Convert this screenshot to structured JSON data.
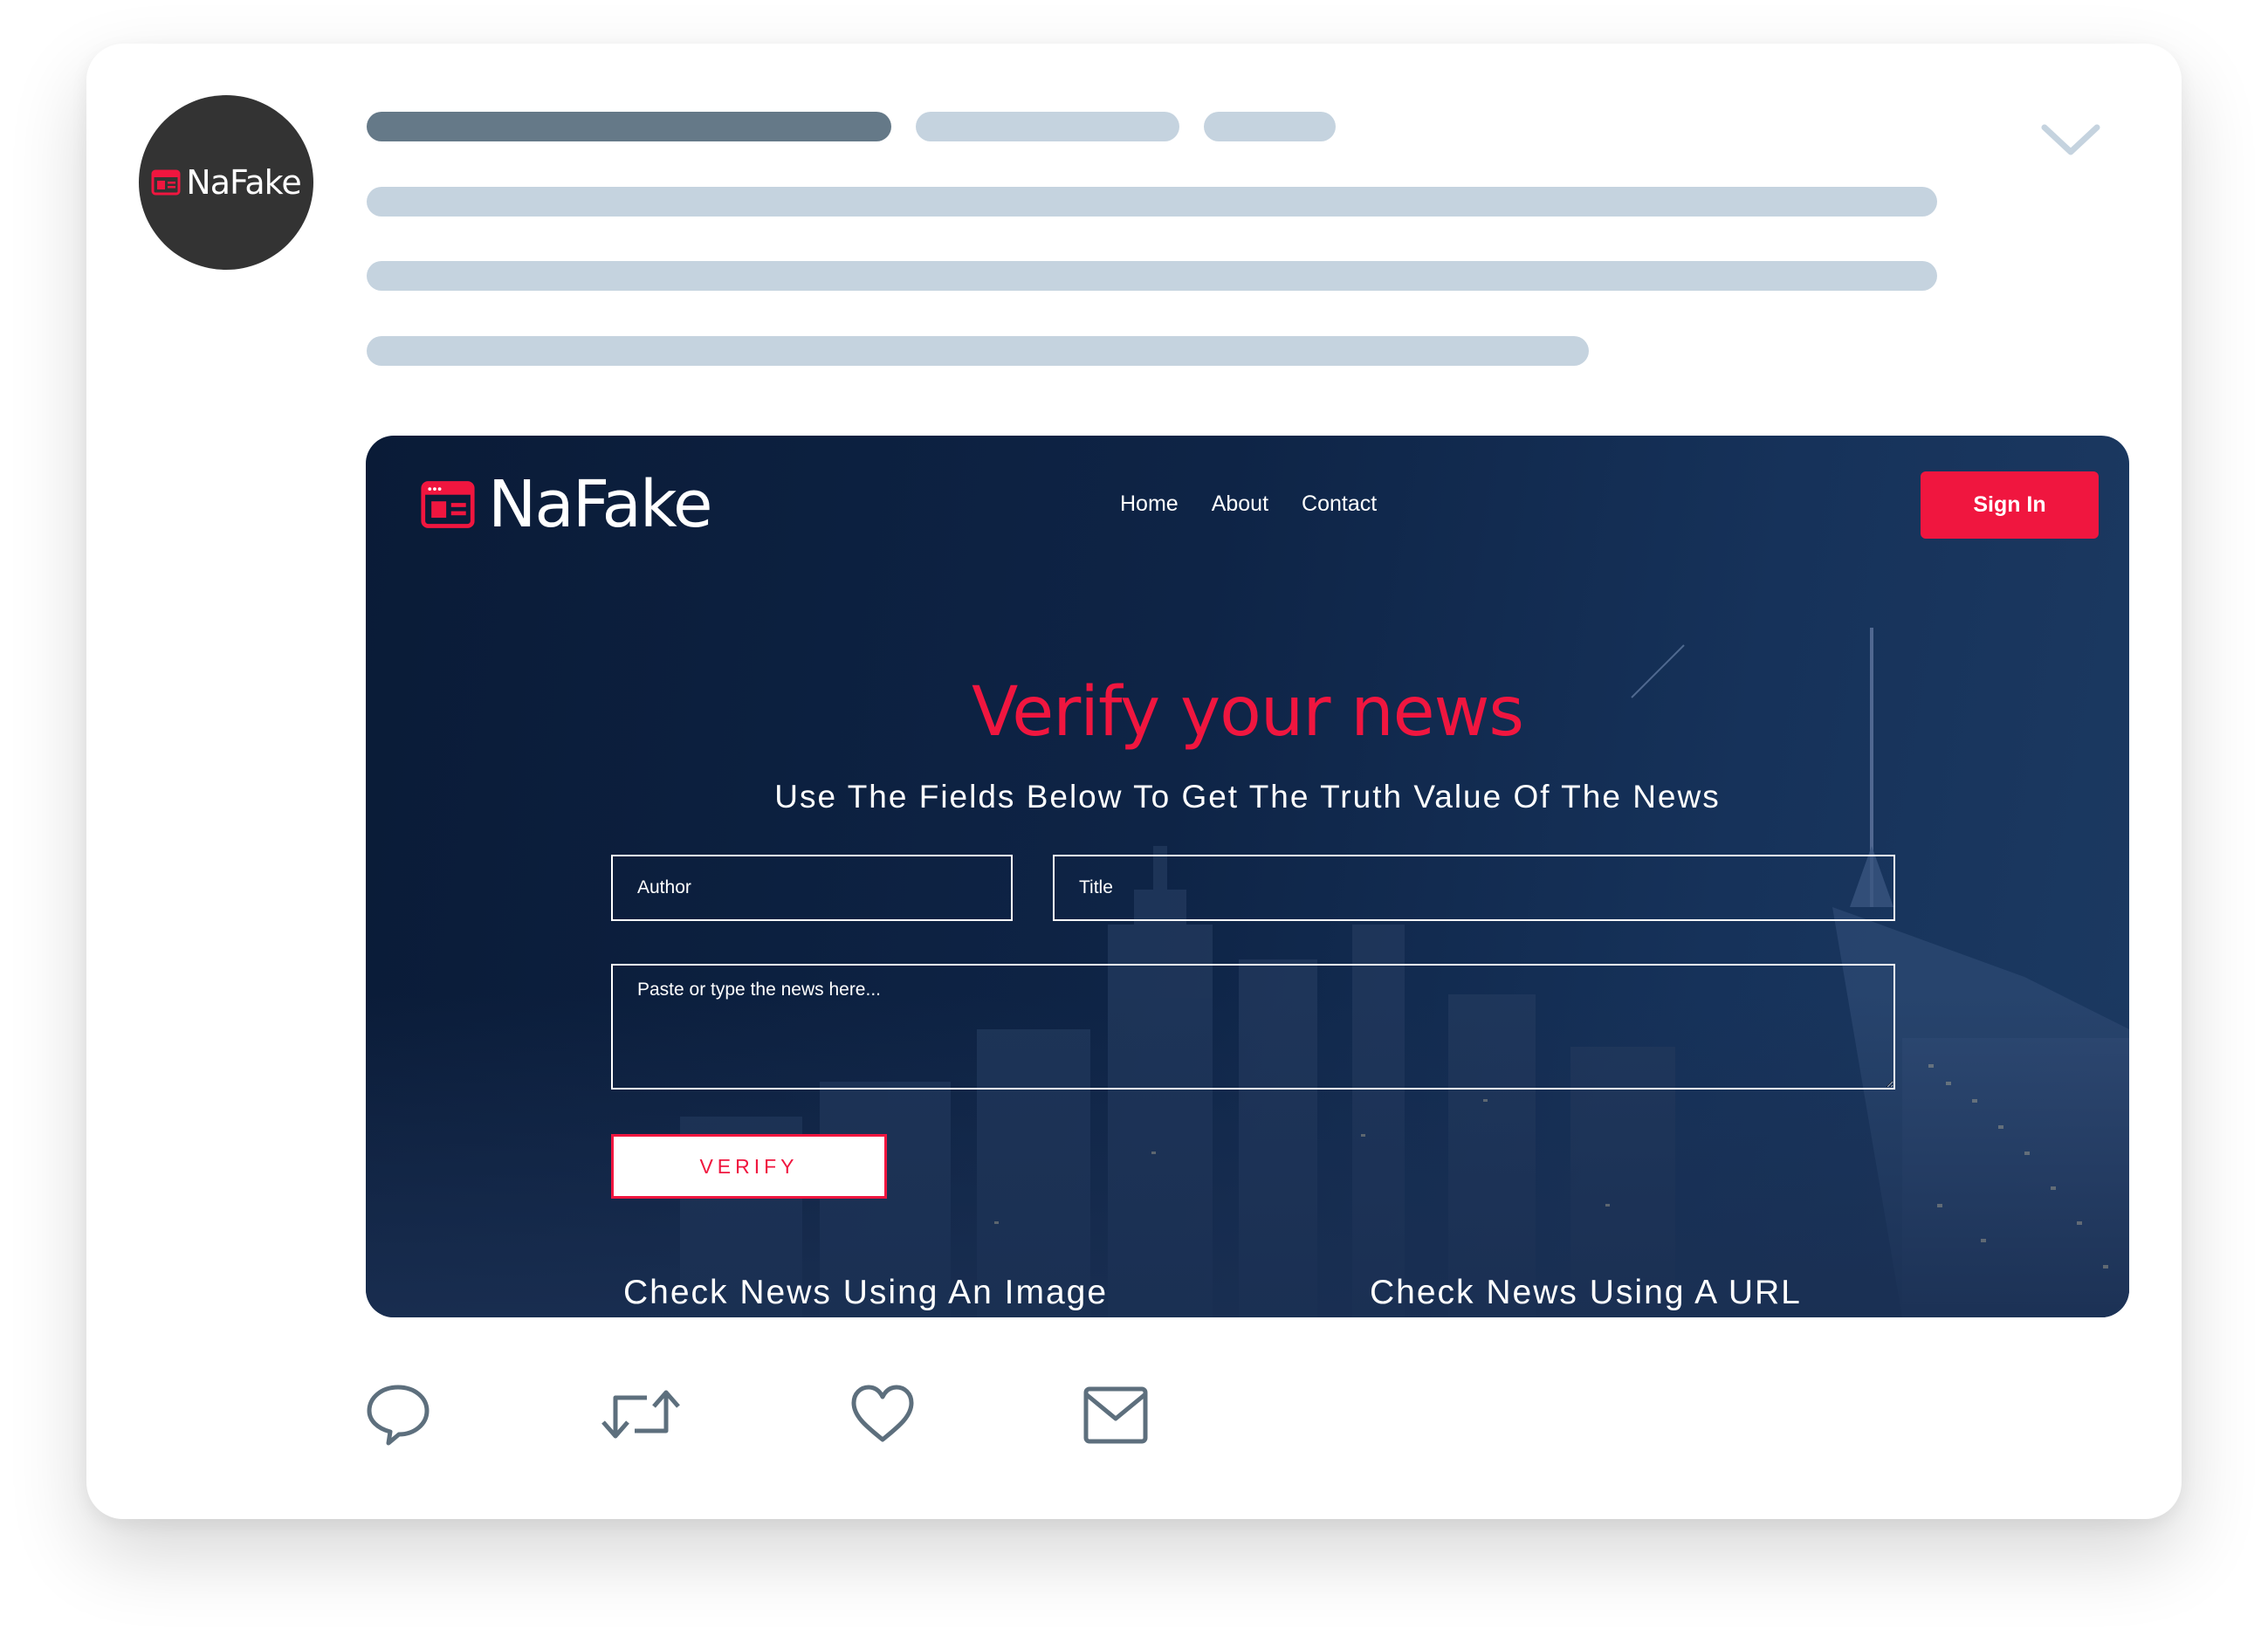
{
  "avatar": {
    "name": "NaFake"
  },
  "preview": {
    "brand": "NaFake",
    "nav": [
      "Home",
      "About",
      "Contact"
    ],
    "sign_in": "Sign In",
    "headline": "Verify your news",
    "subline": "Use The Fields Below To Get The Truth Value Of The News",
    "author_placeholder": "Author",
    "title_placeholder": "Title",
    "news_placeholder": "Paste or type the news here...",
    "verify_label": "VERIFY",
    "image_section": "Check News Using An Image",
    "url_section": "Check News Using A URL"
  },
  "colors": {
    "accent": "#f0163f",
    "skeleton_dark": "#657988",
    "skeleton_light": "#c5d3df",
    "icon": "#5d6f7d",
    "avatar_bg": "#333333"
  },
  "icons": [
    "chevron-down-icon",
    "newspaper-icon",
    "reply-icon",
    "retweet-icon",
    "heart-icon",
    "mail-icon"
  ]
}
